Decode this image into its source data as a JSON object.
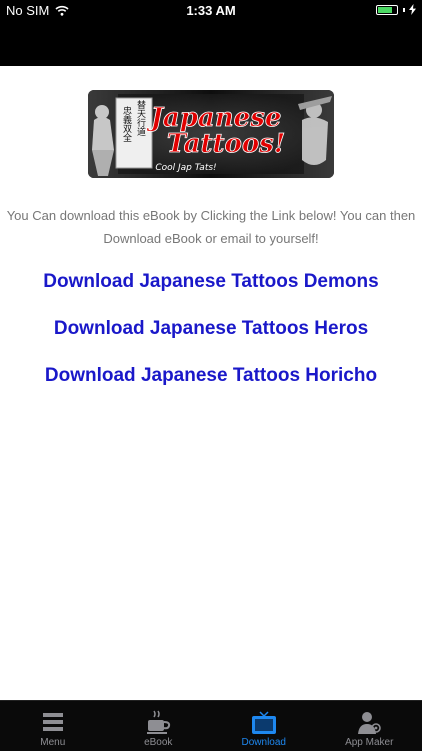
{
  "status_bar": {
    "carrier": "No SIM",
    "time": "1:33 AM",
    "battery_level": 0.75,
    "wifi_icon": "wifi-icon",
    "battery_icon": "battery-icon",
    "charging_icon": "charging-bolt-icon"
  },
  "banner": {
    "title_line1": "Japanese",
    "title_line2": "Tattoos!",
    "tagline": "Cool Jap Tats!",
    "kanji_col1": "替天行道",
    "kanji_col2": "忠義双全"
  },
  "intro_text": {
    "line1": "You Can download this eBook by Clicking the Link below!  You can then",
    "line2": "Download eBook or email to yourself!"
  },
  "download_links": [
    {
      "label": "Download Japanese Tattoos Demons"
    },
    {
      "label": "Download Japanese Tattoos Heros"
    },
    {
      "label": "Download Japanese Tattoos Horicho"
    }
  ],
  "tab_bar": {
    "active": "Download",
    "tabs": [
      {
        "label": "Menu",
        "icon": "menu-icon"
      },
      {
        "label": "eBook",
        "icon": "coffee-cup-icon"
      },
      {
        "label": "Download",
        "icon": "tv-icon"
      },
      {
        "label": "App Maker",
        "icon": "user-icon"
      }
    ]
  },
  "colors": {
    "link": "#1a18c9",
    "active_tab": "#1e88f0",
    "inactive_tab": "#8e8e93",
    "battery": "#4cd964"
  }
}
